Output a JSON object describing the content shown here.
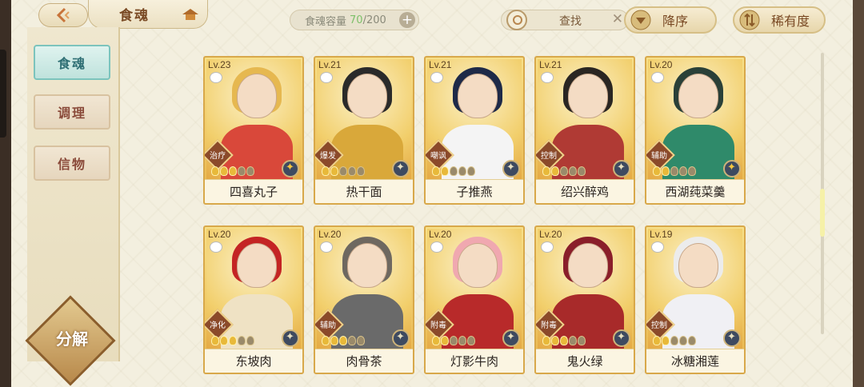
{
  "header": {
    "title": "食魂",
    "capacity_label": "食魂容量",
    "capacity_current": "70",
    "capacity_max": "/200",
    "capacity_add": "+",
    "search_label": "查找",
    "search_clear": "✕",
    "sort_label": "降序",
    "filter_label": "稀有度"
  },
  "sidebar": {
    "tabs": [
      {
        "label": "食魂",
        "active": true
      },
      {
        "label": "调理",
        "active": false
      },
      {
        "label": "信物",
        "active": false
      }
    ],
    "decompose_label": "分解"
  },
  "cards": [
    {
      "level": "Lv.23",
      "role": "治疗",
      "name": "四喜丸子",
      "stars": 3,
      "hair": "#e6b850",
      "body": "#d9483a",
      "element": "gold"
    },
    {
      "level": "Lv.21",
      "role": "爆发",
      "name": "热干面",
      "stars": 2,
      "hair": "#2a2a2a",
      "body": "#d9a83a",
      "element": "dark"
    },
    {
      "level": "Lv.21",
      "role": "嘲讽",
      "name": "子推燕",
      "stars": 2,
      "hair": "#1e2a48",
      "body": "#f4f4f4",
      "element": "dark"
    },
    {
      "level": "Lv.21",
      "role": "控制",
      "name": "绍兴醉鸡",
      "stars": 2,
      "hair": "#2a2622",
      "body": "#b03a34",
      "element": "dark"
    },
    {
      "level": "Lv.20",
      "role": "辅助",
      "name": "西湖莼菜羹",
      "stars": 2,
      "hair": "#2a4038",
      "body": "#2f8a6a",
      "element": "gold"
    },
    {
      "level": "Lv.20",
      "role": "净化",
      "name": "东坡肉",
      "stars": 3,
      "hair": "#c42424",
      "body": "#efe2c4",
      "element": "dark"
    },
    {
      "level": "Lv.20",
      "role": "辅助",
      "name": "肉骨茶",
      "stars": 3,
      "hair": "#6e6860",
      "body": "#6a6a6a",
      "element": "dark"
    },
    {
      "level": "Lv.20",
      "role": "附毒",
      "name": "灯影牛肉",
      "stars": 2,
      "hair": "#f0a8b0",
      "body": "#b82a2a",
      "element": "dark"
    },
    {
      "level": "Lv.20",
      "role": "附毒",
      "name": "鬼火绿",
      "stars": 3,
      "hair": "#8a1e2a",
      "body": "#a82a2a",
      "element": "dark"
    },
    {
      "level": "Lv.19",
      "role": "控制",
      "name": "冰糖湘莲",
      "stars": 2,
      "hair": "#ececec",
      "body": "#f0f0f4",
      "element": "dark"
    }
  ],
  "colors": {
    "accent": "#7cc4bd",
    "card_gold": "#e9b54a",
    "capacity_value": "#7ec06a"
  }
}
